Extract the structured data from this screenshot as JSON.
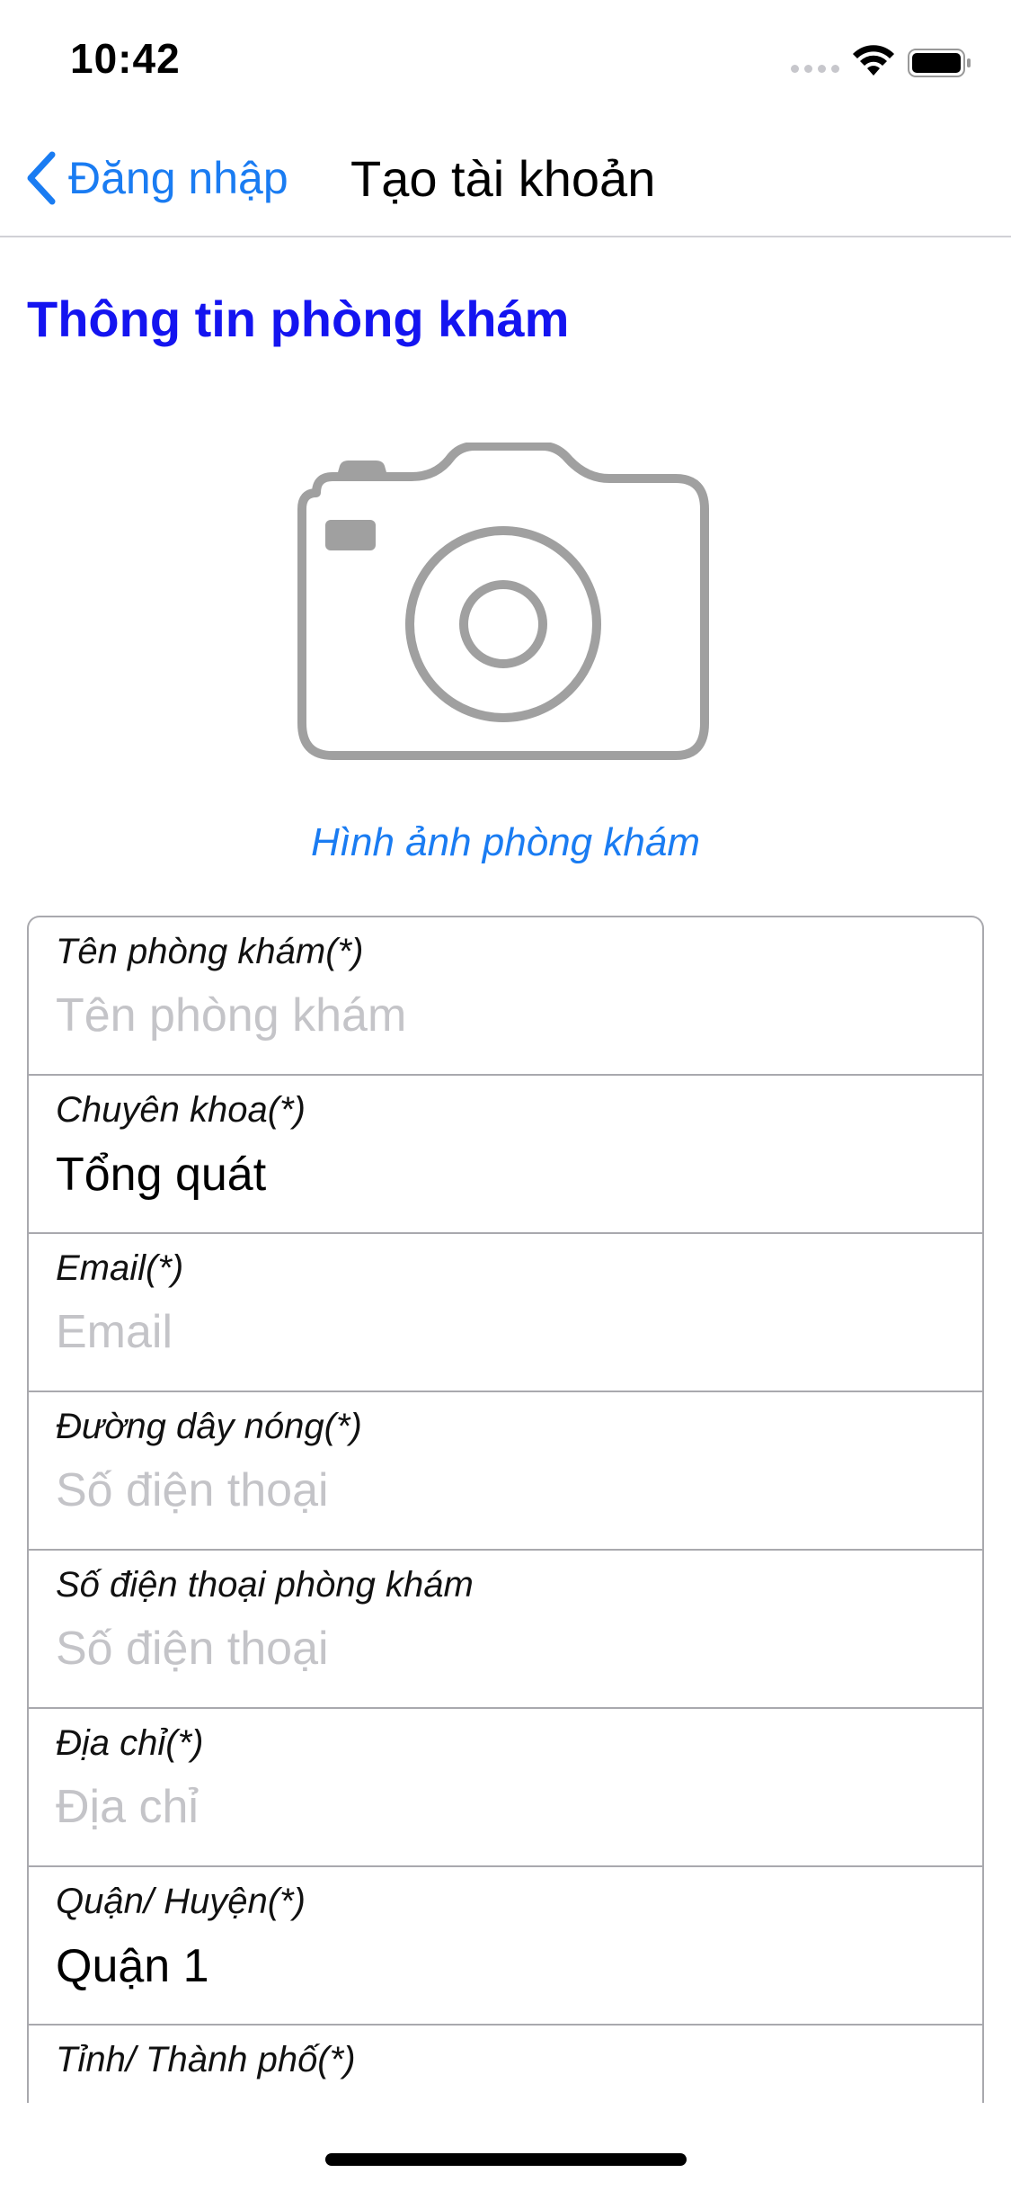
{
  "status_bar": {
    "time": "10:42"
  },
  "nav": {
    "back_label": "Đăng nhập",
    "title": "Tạo tài khoản"
  },
  "section": {
    "title": "Thông tin phòng khám",
    "photo_caption": "Hình ảnh phòng khám"
  },
  "form": {
    "clinic_name": {
      "label": "Tên phòng khám(*)",
      "placeholder": "Tên phòng khám",
      "value": ""
    },
    "specialty": {
      "label": "Chuyên khoa(*)",
      "value": "Tổng quát"
    },
    "email": {
      "label": "Email(*)",
      "placeholder": "Email",
      "value": ""
    },
    "hotline": {
      "label": "Đường dây nóng(*)",
      "placeholder": "Số điện thoại",
      "value": ""
    },
    "clinic_phone": {
      "label": "Số điện thoại phòng khám",
      "placeholder": "Số điện thoại",
      "value": ""
    },
    "address": {
      "label": "Địa chỉ(*)",
      "placeholder": "Địa chỉ",
      "value": ""
    },
    "district": {
      "label": "Quận/ Huyện(*)",
      "value": "Quận 1"
    },
    "province": {
      "label": "Tỉnh/ Thành phố(*)"
    }
  },
  "colors": {
    "accent_blue": "#1a7cf2",
    "section_title": "#1414f0",
    "placeholder": "#c4c4c8",
    "border": "#a9a9ae",
    "camera_icon": "#a0a0a0"
  },
  "icons": {
    "back": "chevron-left-icon",
    "camera": "camera-icon",
    "wifi": "wifi-icon",
    "battery": "battery-icon",
    "signal": "signal-dots-icon"
  }
}
